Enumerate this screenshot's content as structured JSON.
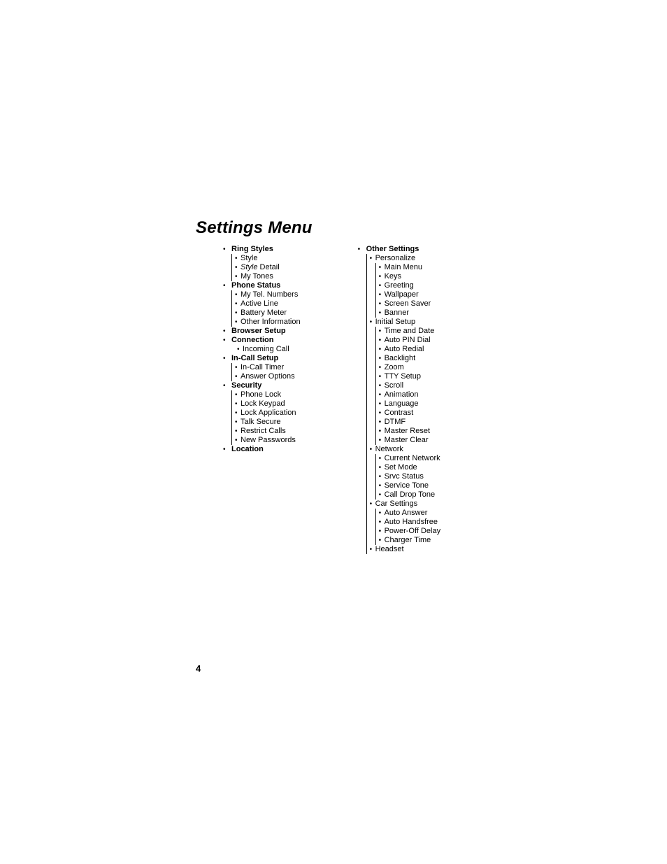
{
  "title": "Settings Menu",
  "page_number": "4",
  "left": [
    {
      "label": "Ring Styles",
      "bold": true,
      "children": [
        {
          "label": "Style"
        },
        {
          "label_html": "<span class='italic'>Style</span> Detail"
        },
        {
          "label": "My Tones"
        }
      ]
    },
    {
      "label": "Phone Status",
      "bold": true,
      "children": [
        {
          "label": "My Tel. Numbers"
        },
        {
          "label": "Active Line"
        },
        {
          "label": "Battery Meter"
        },
        {
          "label": "Other Information"
        }
      ]
    },
    {
      "label": "Browser Setup",
      "bold": true
    },
    {
      "label": "Connection",
      "bold": true,
      "children": [
        {
          "label": "Incoming Call"
        }
      ]
    },
    {
      "label": "In-Call Setup",
      "bold": true,
      "children": [
        {
          "label": "In-Call Timer"
        },
        {
          "label": "Answer Options"
        }
      ]
    },
    {
      "label": "Security",
      "bold": true,
      "children": [
        {
          "label": "Phone Lock"
        },
        {
          "label": "Lock Keypad"
        },
        {
          "label": "Lock Application"
        },
        {
          "label": "Talk Secure"
        },
        {
          "label": "Restrict Calls"
        },
        {
          "label": "New Passwords"
        }
      ]
    },
    {
      "label": "Location",
      "bold": true
    }
  ],
  "right": [
    {
      "label": "Other Settings",
      "bold": true,
      "children": [
        {
          "label": "Personalize",
          "children": [
            {
              "label": "Main Menu"
            },
            {
              "label": "Keys"
            },
            {
              "label": "Greeting"
            },
            {
              "label": "Wallpaper"
            },
            {
              "label": "Screen Saver"
            },
            {
              "label": "Banner"
            }
          ]
        },
        {
          "label": "Initial Setup",
          "children": [
            {
              "label": "Time and Date"
            },
            {
              "label": "Auto PIN Dial"
            },
            {
              "label": "Auto Redial"
            },
            {
              "label": "Backlight"
            },
            {
              "label": "Zoom"
            },
            {
              "label": "TTY Setup"
            },
            {
              "label": "Scroll"
            },
            {
              "label": "Animation"
            },
            {
              "label": "Language"
            },
            {
              "label": "Contrast"
            },
            {
              "label": "DTMF"
            },
            {
              "label": "Master Reset"
            },
            {
              "label": "Master Clear"
            }
          ]
        },
        {
          "label": "Network",
          "children": [
            {
              "label": "Current Network"
            },
            {
              "label": "Set Mode"
            },
            {
              "label": "Srvc Status"
            },
            {
              "label": "Service Tone"
            },
            {
              "label": "Call Drop Tone"
            }
          ]
        },
        {
          "label": "Car Settings",
          "children": [
            {
              "label": "Auto Answer"
            },
            {
              "label": "Auto Handsfree"
            },
            {
              "label": "Power-Off Delay"
            },
            {
              "label": "Charger Time"
            }
          ]
        },
        {
          "label": "Headset"
        }
      ]
    }
  ]
}
